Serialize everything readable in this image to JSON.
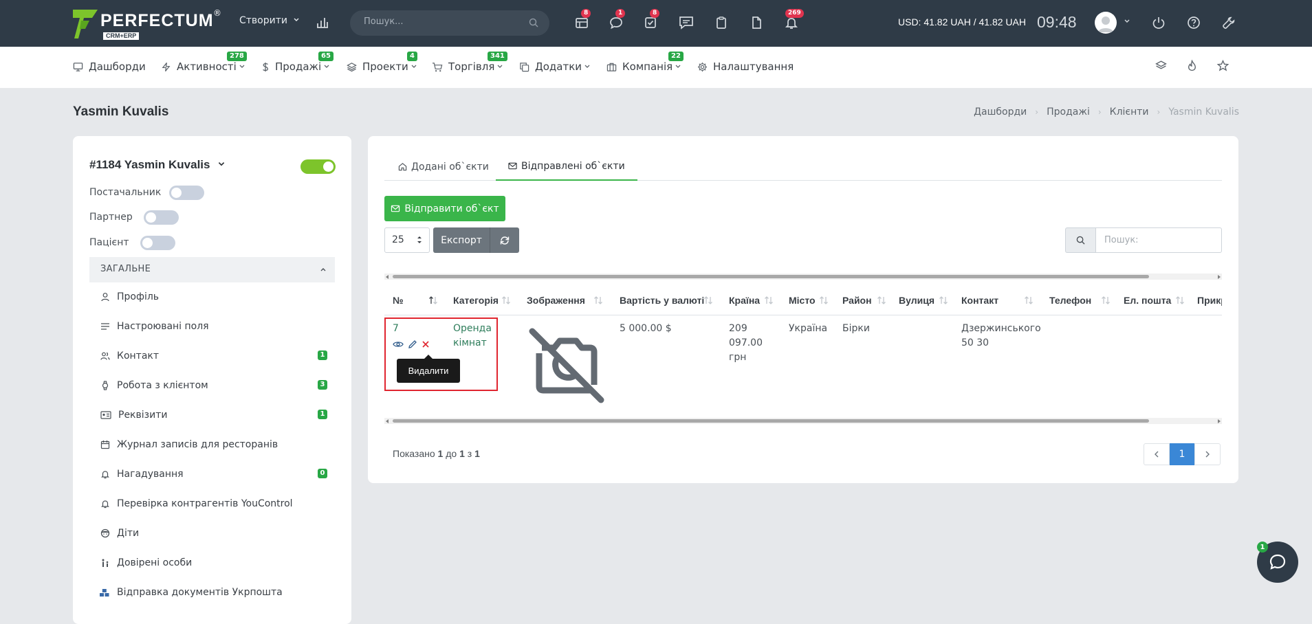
{
  "topbar": {
    "logo_text": "PERFECTUM",
    "logo_reg": "®",
    "logo_sub": "CRM+ERP",
    "create_label": "Створити",
    "search_placeholder": "Пошук...",
    "badges": {
      "notes": "8",
      "chat": "1",
      "tasks": "8",
      "bell": "269"
    },
    "currency": "USD: 41.82 UAH / 41.82 UAH",
    "clock": "09:48"
  },
  "nav": {
    "items": [
      {
        "label": "Дашборди",
        "icon": "monitor-icon",
        "badge": ""
      },
      {
        "label": "Активності",
        "icon": "bolt-icon",
        "badge": "278"
      },
      {
        "label": "Продажі",
        "icon": "dollar-icon",
        "badge": "65"
      },
      {
        "label": "Проекти",
        "icon": "layers-icon",
        "badge": "4"
      },
      {
        "label": "Торгівля",
        "icon": "cart-icon",
        "badge": "341"
      },
      {
        "label": "Додатки",
        "icon": "copy-icon",
        "badge": ""
      },
      {
        "label": "Компанія",
        "icon": "briefcase-icon",
        "badge": "22"
      },
      {
        "label": "Налаштування",
        "icon": "gear-icon",
        "badge": ""
      }
    ]
  },
  "page": {
    "title": "Yasmin Kuvalis",
    "breadcrumb": [
      "Дашборди",
      "Продажі",
      "Клієнти",
      "Yasmin Kuvalis"
    ]
  },
  "client": {
    "name": "#1184 Yasmin Kuvalis",
    "options": [
      "Постачальник",
      "Партнер",
      "Пацієнт"
    ],
    "section": "ЗАГАЛЬНЕ",
    "menu": [
      {
        "label": "Профіль",
        "icon": "user-icon",
        "badge": ""
      },
      {
        "label": "Настроювані поля",
        "icon": "list-icon",
        "badge": ""
      },
      {
        "label": "Контакт",
        "icon": "users-icon",
        "badge": "1"
      },
      {
        "label": "Робота з клієнтом",
        "icon": "watch-icon",
        "badge": "3"
      },
      {
        "label": "Реквізити",
        "icon": "id-card-icon",
        "badge": "1"
      },
      {
        "label": "Журнал записів для ресторанів",
        "icon": "calendar-icon",
        "badge": ""
      },
      {
        "label": "Нагадування",
        "icon": "bell-icon",
        "badge": "0"
      },
      {
        "label": "Перевірка контрагентів YouControl",
        "icon": "bell-icon",
        "badge": ""
      },
      {
        "label": "Діти",
        "icon": "child-icon",
        "badge": ""
      },
      {
        "label": "Довірені особи",
        "icon": "persons-icon",
        "badge": ""
      },
      {
        "label": "Відправка документів Укрпошта",
        "icon": "boxes-icon",
        "badge": ""
      }
    ]
  },
  "content": {
    "tabs": [
      "Додані об`єкти",
      "Відправлені об`єкти"
    ],
    "send_button": "Відправити об`єкт",
    "per_page": "25",
    "export_label": "Експорт",
    "search_placeholder": "Пошук:",
    "columns": [
      "№",
      "Категорія",
      "Зображення",
      "Вартість у валюті",
      "Країна",
      "Місто",
      "Район",
      "Вулиця",
      "Контакт",
      "Телефон",
      "Ел. пошта",
      "Прикрі"
    ],
    "row": {
      "id": "7",
      "category_1": "Оренда",
      "category_2": "кімнат",
      "price": "5 000.00 $",
      "country_1": "209",
      "country_2": "097.00",
      "country_3": "грн",
      "city": "Україна",
      "district": "Бірки",
      "street": "",
      "contact_1": "Дзержинського",
      "contact_2": "50 30"
    },
    "tooltip": "Видалити",
    "shown_prefix": "Показано ",
    "shown_from": "1",
    "shown_mid1": " до ",
    "shown_to": "1",
    "shown_mid2": " з ",
    "shown_total": "1",
    "page_current": "1"
  },
  "chat": {
    "badge": "1"
  },
  "colors": {
    "topbar": "#2f3b47",
    "accent_green": "#3ab54a",
    "danger": "#e0252f",
    "primary": "#3a87d6"
  }
}
